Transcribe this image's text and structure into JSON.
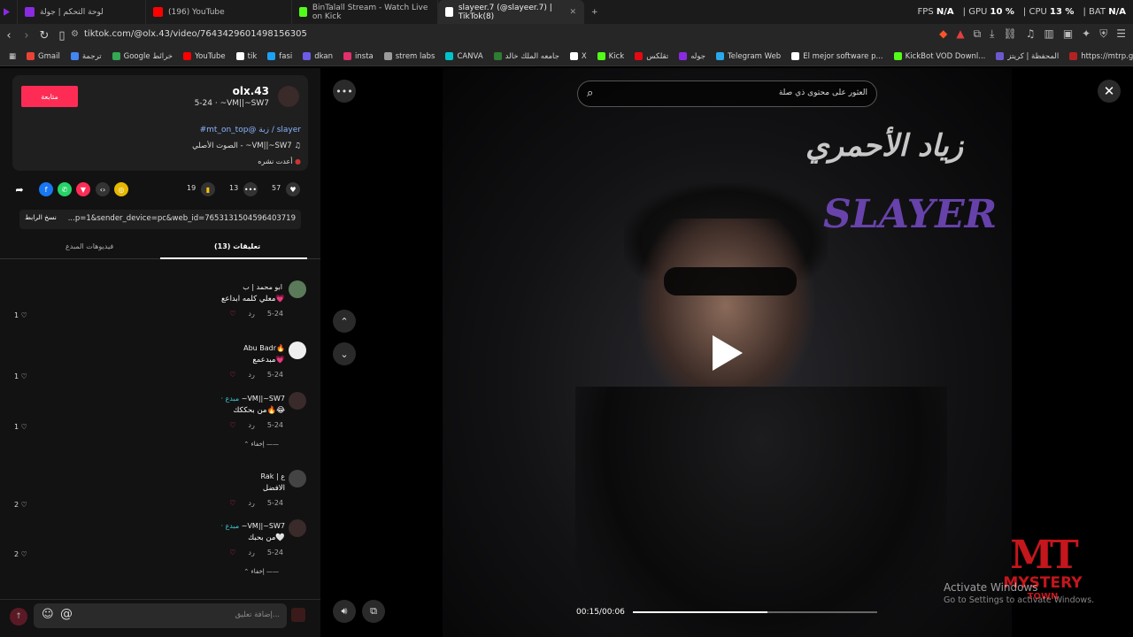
{
  "tabs": [
    {
      "label": "لوحة التحكم | جولة",
      "favicon_color": "#8a2be2"
    },
    {
      "label": "(196) YouTube",
      "favicon_color": "#ff0000"
    },
    {
      "label": "BinTalall Stream - Watch Live on Kick",
      "favicon_color": "#53fc18"
    },
    {
      "label": "slayeer.7 (@slayeer.7) | TikTok(8)",
      "favicon_color": "#ffffff",
      "active": true
    }
  ],
  "perf": {
    "fps_label": "FPS",
    "fps": "N/A",
    "gpu_label": "GPU",
    "gpu": "10 %",
    "cpu_label": "CPU",
    "cpu": "13 %",
    "bat_label": "BAT",
    "bat": "N/A"
  },
  "url": "tiktok.com/@olx.43/video/7643429601498156305",
  "bookmarks": [
    "Gmail",
    "ترجمة",
    "Google خرائط",
    "YouTube",
    "tik",
    "fasi",
    "dkan",
    "insta",
    "strem labs",
    "CANVA",
    "جامعه الملك خالد",
    "X",
    "Kick",
    "تقلكس",
    "جوله",
    "Telegram Web",
    "El mejor software p...",
    "KickBot VOD Downl...",
    "المحفظة | كريتز",
    "https://mtrp.gg/"
  ],
  "profile": {
    "follow_label": "متابعة",
    "username": "olx.43",
    "subline": "5-24 · ~VM||~SW7",
    "tags": "#mt_on_top@ زبة / slayer",
    "sound": "الصوت الأصلي - ~VM||~SW7",
    "repost": "أعدت نشره"
  },
  "actions": {
    "likes": "57",
    "comments": "13",
    "saves": "19"
  },
  "copy": {
    "button": "نسخ الرابط",
    "url": "...p=1&sender_device=pc&web_id=7653131504596403719"
  },
  "tabs_section": {
    "comments_tab": "تعليقات (13)",
    "creator_tab": "فيديوهات المبدع"
  },
  "comments": [
    {
      "name": "ابو محمد | ب",
      "text": "معلي كلمه ابداعع💗",
      "date": "5-24",
      "reply": "رد",
      "likes": "1",
      "creator": ""
    },
    {
      "name": "Abu Badr🔥",
      "text": "مبدعمع💗",
      "date": "5-24",
      "reply": "رد",
      "likes": "1",
      "creator": ""
    },
    {
      "name": "~VM||~SW7",
      "text": "من بحككك🔥😂",
      "date": "5-24",
      "reply": "رد",
      "likes": "1",
      "creator": "· مبدع"
    },
    {
      "name": "Rak | ع",
      "text": "الافضل",
      "date": "5-24",
      "reply": "رد",
      "likes": "2",
      "creator": ""
    },
    {
      "name": "~VM||~SW7",
      "text": "من بحبك🤍",
      "date": "5-24",
      "reply": "رد",
      "likes": "2",
      "creator": "· مبدع"
    }
  ],
  "hide_label": "إخفاء",
  "input": {
    "placeholder": "إضافة تعليق..."
  },
  "video": {
    "search_placeholder": "العثور على محتوى ذي صلة",
    "time": "00:15/00:06",
    "progress": 0.55,
    "overlay_arabic": "زياد الأحمري",
    "overlay_slayer": "SLAYER"
  },
  "mt_logo": {
    "mark": "MT",
    "line1": "MYSTERY",
    "line2": "TOWN"
  },
  "windows": {
    "line1": "Activate Windows",
    "line2": "Go to Settings to activate Windows."
  }
}
